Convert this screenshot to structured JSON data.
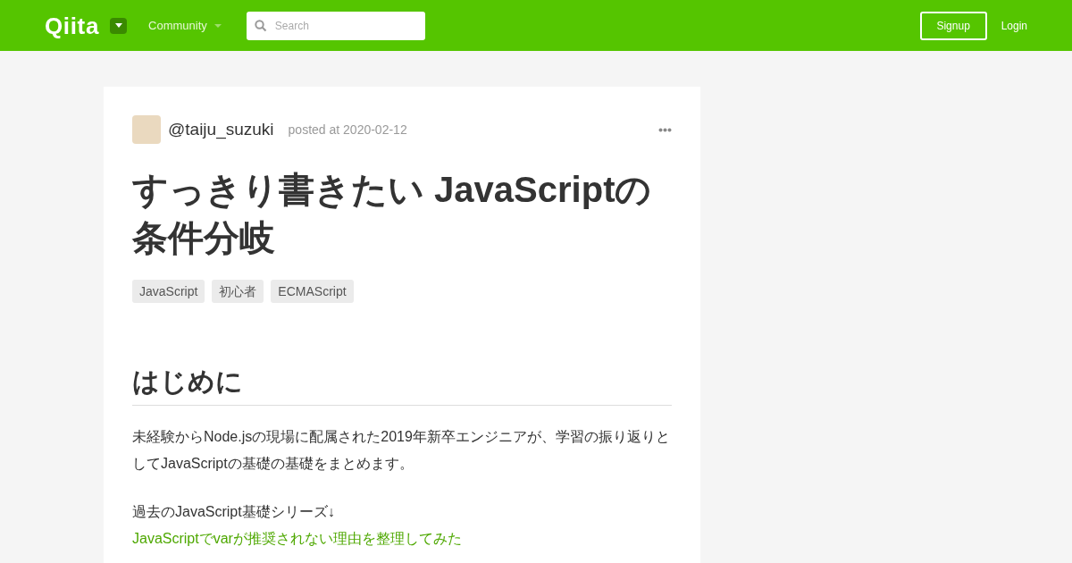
{
  "header": {
    "logo": "Qiita",
    "community": "Community",
    "search": {
      "placeholder": "Search"
    },
    "signup": "Signup",
    "login": "Login"
  },
  "article": {
    "author": "@taiju_suzuki",
    "posted": "posted at 2020-02-12",
    "title": "すっきり書きたい JavaScriptの条件分岐",
    "tags": [
      "JavaScript",
      "初心者",
      "ECMAScript"
    ],
    "heading": "はじめに",
    "paragraph": "未経験からNode.jsの現場に配属された2019年新卒エンジニアが、学習の振り返りとしてJavaScriptの基礎の基礎をまとめます。",
    "series_label": "過去のJavaScript基礎シリーズ↓",
    "link": "JavaScriptでvarが推奨されない理由を整理してみた"
  }
}
